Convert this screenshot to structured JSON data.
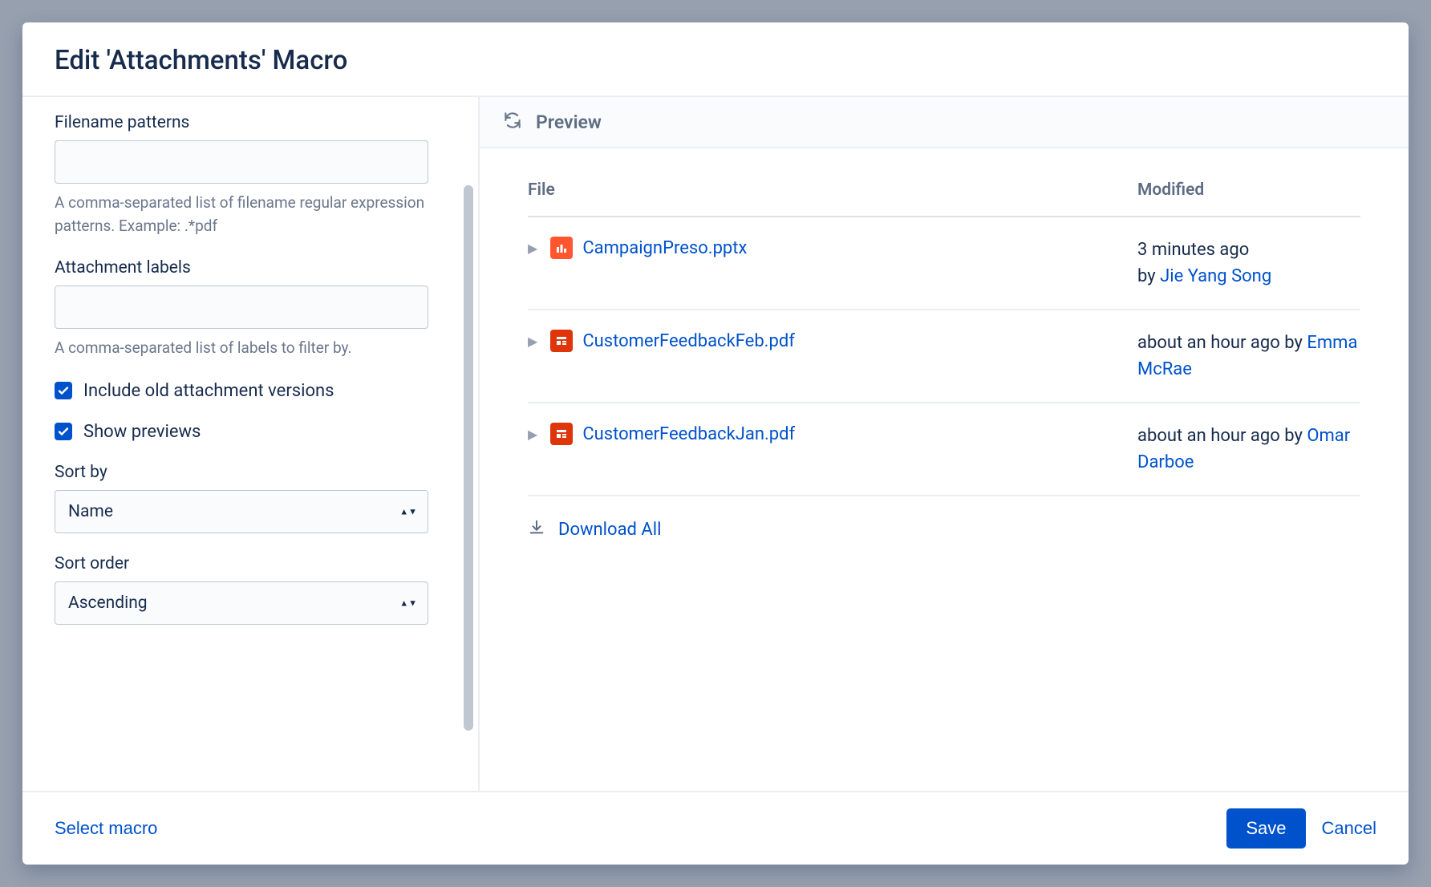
{
  "header": {
    "title": "Edit 'Attachments' Macro"
  },
  "form": {
    "filename": {
      "label": "Filename patterns",
      "value": "",
      "help": "A comma-separated list of filename regular expression patterns. Example: .*pdf"
    },
    "labels": {
      "label": "Attachment labels",
      "value": "",
      "help": "A comma-separated list of labels to filter by."
    },
    "include_old": {
      "label": "Include old attachment versions",
      "checked": true
    },
    "show_previews": {
      "label": "Show previews",
      "checked": true
    },
    "sort_by": {
      "label": "Sort by",
      "selected": "Name"
    },
    "sort_order": {
      "label": "Sort order",
      "selected": "Ascending"
    }
  },
  "preview": {
    "title": "Preview",
    "columns": {
      "file": "File",
      "modified": "Modified"
    },
    "rows": [
      {
        "name": "CampaignPreso.pptx",
        "icon": "chart",
        "time": "3 minutes ago",
        "by_prefix": "by ",
        "user": "Jie Yang Song"
      },
      {
        "name": "CustomerFeedbackFeb.pdf",
        "icon": "doc",
        "time": "about an hour ago",
        "by_prefix": " by ",
        "user": "Emma McRae"
      },
      {
        "name": "CustomerFeedbackJan.pdf",
        "icon": "doc",
        "time": "about an hour ago",
        "by_prefix": " by ",
        "user": "Omar Darboe"
      }
    ],
    "download_all": "Download All"
  },
  "footer": {
    "select_macro": "Select macro",
    "save": "Save",
    "cancel": "Cancel"
  }
}
